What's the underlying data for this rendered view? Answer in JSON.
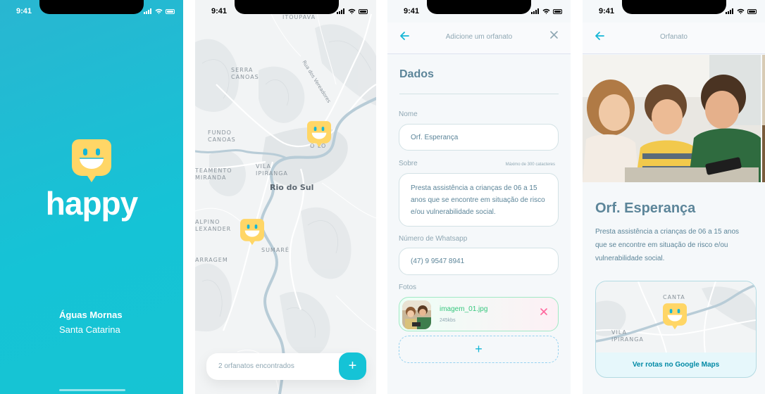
{
  "status_time": "9:41",
  "splash": {
    "brand": "happy",
    "city": "Águas Mornas",
    "state": "Santa Catarina"
  },
  "map_screen": {
    "labels": [
      {
        "text": "ITOUPAVA"
      },
      {
        "text": "Rua dos Vereadores"
      },
      {
        "text": "SERRA\nCANOAS"
      },
      {
        "text": "FUNDO\nCANOAS"
      },
      {
        "text": "VILA\nIPIRANGA"
      },
      {
        "text": "TEAMENTO\nMIRANDA"
      },
      {
        "text": "Rio do Sul"
      },
      {
        "text": "ALPINO\nLEXANDER"
      },
      {
        "text": "SUMARÉ"
      },
      {
        "text": "ARRAGEM"
      },
      {
        "text": "O LO"
      }
    ],
    "footer_text": "2 orfanatos encontrados",
    "add_button_label": "+"
  },
  "form": {
    "header_title": "Adicione um orfanato",
    "back_icon": "arrow-left-icon",
    "close_icon": "close-icon",
    "section_title": "Dados",
    "name_label": "Nome",
    "name_value": "Orf. Esperança",
    "about_label": "Sobre",
    "about_hint": "Máximo de 300 catacteres",
    "about_value": "Presta assistência a crianças de 06 a 15 anos que se encontre em situação de risco e/ou vulnerabilidade social.",
    "whatsapp_label": "Número de Whatsapp",
    "whatsapp_value": "(47) 9 9547 8941",
    "photos_label": "Fotos",
    "photo_name": "imagem_01.jpg",
    "photo_size": "245kbs",
    "add_photo_label": "+"
  },
  "detail": {
    "header_title": "Orfanato",
    "title": "Orf. Esperança",
    "description": "Presta assistência a crianças de 06 a 15 anos que se encontre em situação de risco e/ou vulnerabilidade social.",
    "map_labels": [
      {
        "text": "CANTA"
      },
      {
        "text": "VILA\nIPIRANGA"
      }
    ],
    "routes_label": "Ver rotas no Google Maps"
  },
  "colors": {
    "brand_cyan": "#15c3d6",
    "pin_yellow": "#ffd666",
    "text_primary": "#5c8599",
    "text_muted": "#8fa7b3",
    "success_green": "#37c77f",
    "danger_pink": "#ff669d"
  }
}
